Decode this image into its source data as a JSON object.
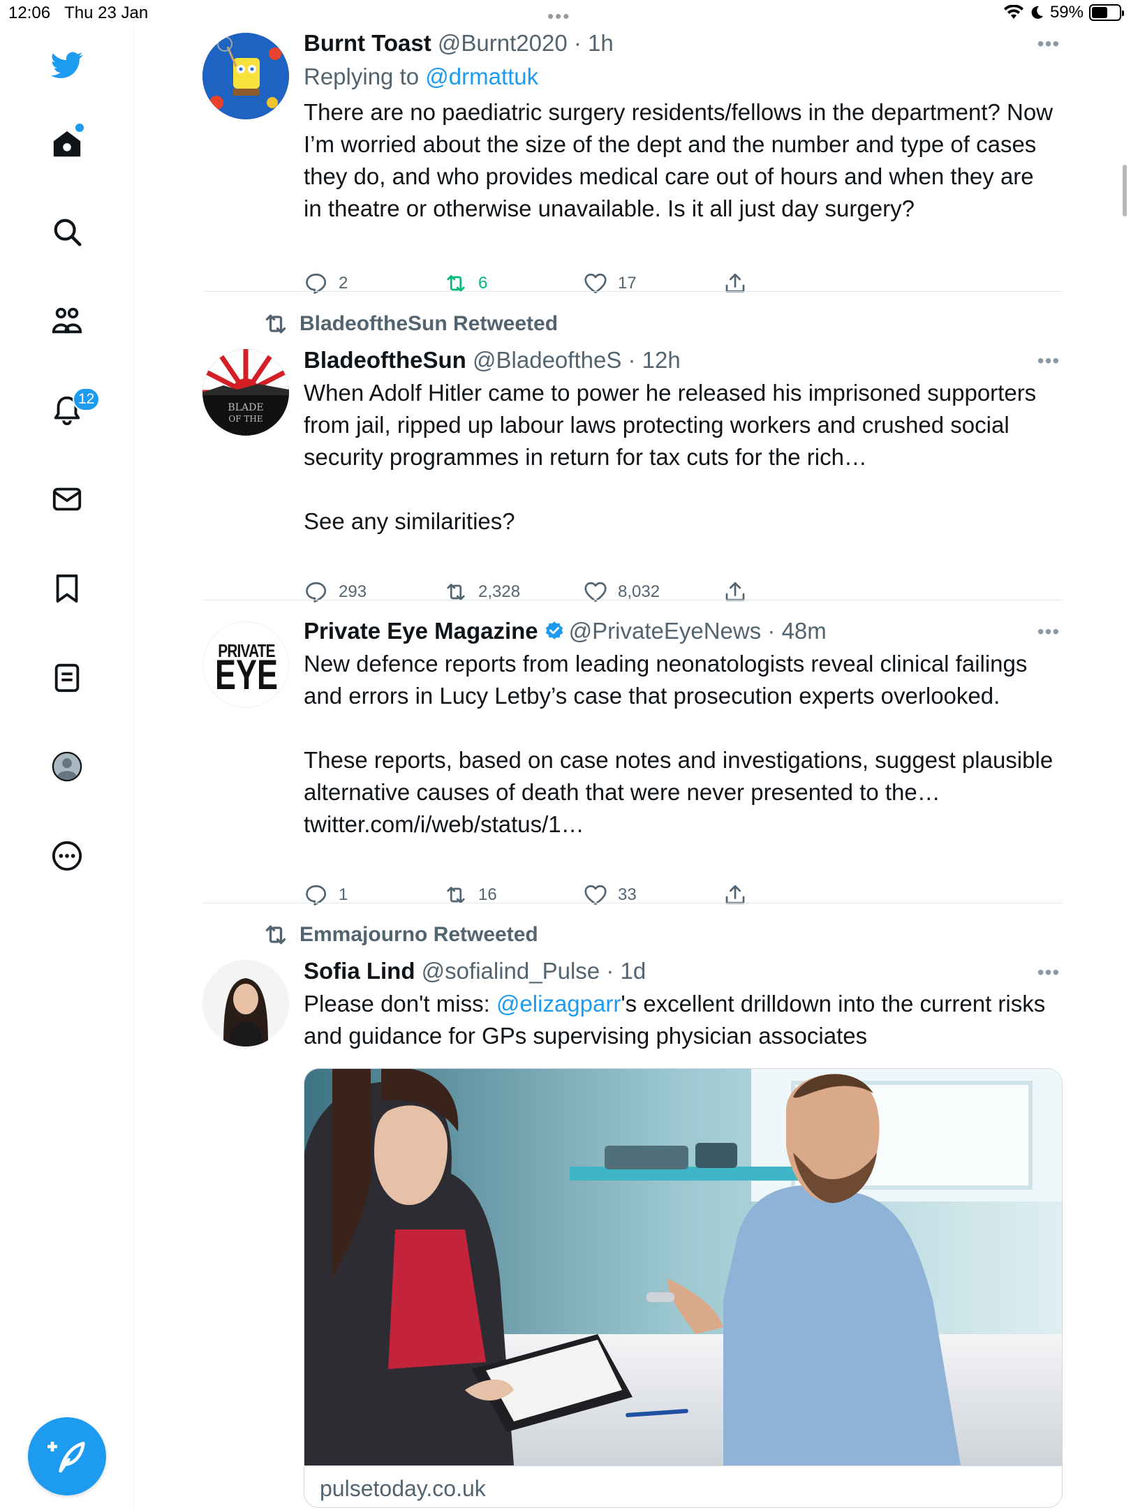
{
  "status_bar": {
    "time": "12:06",
    "date": "Thu 23 Jan",
    "battery": "59%",
    "battery_level": 0.59
  },
  "sidebar": {
    "items": [
      {
        "icon": "twitter-bird-icon"
      },
      {
        "icon": "home-icon"
      },
      {
        "icon": "search-icon"
      },
      {
        "icon": "communities-icon"
      },
      {
        "icon": "notifications-icon",
        "badge": "12"
      },
      {
        "icon": "messages-icon"
      },
      {
        "icon": "bookmarks-icon"
      },
      {
        "icon": "lists-icon"
      },
      {
        "icon": "profile-icon"
      },
      {
        "icon": "more-icon"
      }
    ],
    "compose_icon": "compose-icon"
  },
  "tweets": [
    {
      "name": "Burnt Toast",
      "handle": "@Burnt2020",
      "time": "· 1h",
      "replying_prefix": "Replying to ",
      "replying_to": "@drmattuk",
      "text": "There are no paediatric surgery residents/fellows in the department? Now I’m worried about the size of the dept and the number and type of cases they do, and who provides medical care out of hours and when they are in theatre or otherwise unavailable. Is it all just day surgery?",
      "replies": "2",
      "retweets": "6",
      "likes": "17",
      "retweeted_by_me": true
    },
    {
      "retweeted_by": "BladeoftheSun Retweeted",
      "name": "BladeoftheSun",
      "handle": "@BladeoftheS",
      "time": "· 12h",
      "text": "When Adolf Hitler came to power he released his imprisoned supporters from jail, ripped up labour laws protecting workers and crushed social security programmes in return for tax cuts for the rich…\n\nSee any similarities?",
      "avatar_text": "BLADE\nOF THE",
      "replies": "293",
      "retweets": "2,328",
      "likes": "8,032"
    },
    {
      "name": "Private Eye Magazine",
      "handle": "@PrivateEyeNews",
      "time": "· 48m",
      "verified": true,
      "avatar_text_top": "PRIVATE",
      "avatar_text_bottom": "EYE",
      "text": "New defence reports from leading neonatologists reveal clinical failings and errors in Lucy Letby’s case that prosecution experts overlooked.\n\nThese reports, based on case notes and investigations, suggest plausible alternative causes of death that were never presented to the…",
      "link": "twitter.com/i/web/status/1…",
      "replies": "1",
      "retweets": "16",
      "likes": "33"
    },
    {
      "retweeted_by": "Emmajourno Retweeted",
      "name": "Sofia Lind",
      "handle": "@sofialind_Pulse",
      "time": "· 1d",
      "text_prefix": "Please don't miss: ",
      "mention": "@elizagparr",
      "text_suffix": "'s excellent drilldown into the current risks and guidance for GPs supervising physician associates",
      "card_domain": "pulsetoday.co.uk"
    }
  ],
  "colors": {
    "accent": "#1d9bf0",
    "retweet_green": "#00ba7c",
    "muted": "#536471"
  }
}
